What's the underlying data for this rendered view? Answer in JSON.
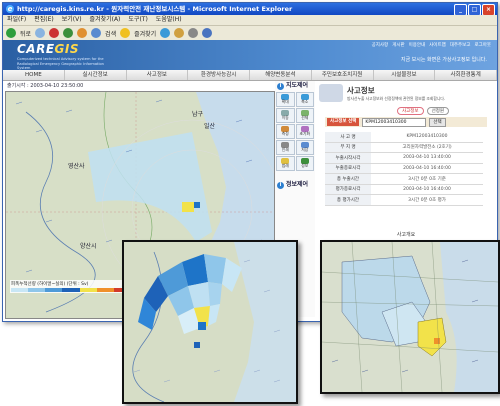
{
  "window": {
    "title": "http://caregis.kins.re.kr - 원자력안전 재난정보시스템 - Microsoft Internet Explorer"
  },
  "menubar": [
    "파일(F)",
    "편집(E)",
    "보기(V)",
    "즐겨찾기(A)",
    "도구(T)",
    "도움말(H)"
  ],
  "toolbar": {
    "back": "뒤로",
    "search": "검색",
    "favorites": "즐겨찾기"
  },
  "site": {
    "logo_main": "CARE",
    "logo_accent": "GIS",
    "logo_sub": "Computerized technical Advisory system for the Radiological Emergency Geographic Information System",
    "toplinks": [
      "공지사항",
      "게시판",
      "이용안내",
      "사이트맵",
      "대주주보고",
      "로그아웃"
    ],
    "notice": "지금 보시는 화면은 가상사고정보 입니다.",
    "nav": [
      "HOME",
      "실시간정보",
      "사고정보",
      "환경방사능감시",
      "해양변동분석",
      "주민보호조치지원",
      "시설물정보",
      "사회환경통계"
    ]
  },
  "map": {
    "timestamp": "출기시각 : 2003-04-10 23:50:00",
    "labels": [
      "남구",
      "일산",
      "영산사",
      "양산시",
      "부산",
      "동구"
    ],
    "legend": "피폭누적선량 (하이얼~실의)   (단위 : Sv)"
  },
  "tools": {
    "title": "지도제어",
    "buttons": [
      "확대",
      "축소",
      "이동",
      "전체",
      "측정",
      "초기화",
      "인쇄",
      "저장",
      "범례",
      "정보"
    ],
    "info_title": "정보제어"
  },
  "info": {
    "title": "사고정보",
    "desc": "방사선누출 사고정보와 선정정책에 관련된 정보를 조회합니다.",
    "pill1": "사고정보",
    "pill2": "선정원",
    "select_label": "사고정보 선택",
    "select_value": "KPM12003410300",
    "select_btn": "선택",
    "rows": [
      {
        "k": "사 고 명",
        "v": "KPM12003410300"
      },
      {
        "k": "부 지 명",
        "v": "고리원자력발전소 (2호기)"
      },
      {
        "k": "누출시작시각",
        "v": "2003-04-10 13:40:00"
      },
      {
        "k": "누출종료시각",
        "v": "2003-04-10 16:40:00"
      },
      {
        "k": "총 누출시간",
        "v": "3시간 0분 0초 기준"
      },
      {
        "k": "평가종료시각",
        "v": "2003-04-10 16:40:00"
      },
      {
        "k": "총 평가시간",
        "v": "3시간 0분 0초 평가"
      }
    ],
    "overview": "사고개요"
  },
  "colors": {
    "titlebar": "#1f5bd6",
    "header": "#2a5fa3",
    "plume_light": "#bfe0f2",
    "plume_dark": "#1e74c8",
    "plume_yellow": "#f2e24a"
  }
}
